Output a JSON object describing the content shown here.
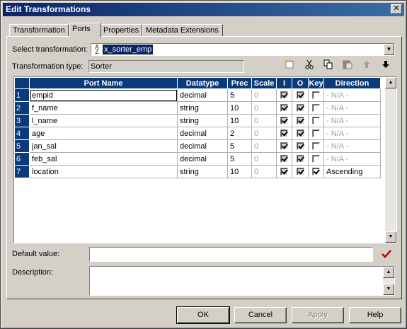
{
  "window": {
    "title": "Edit Transformations",
    "close_glyph": "✕"
  },
  "tabs": [
    {
      "label": "Transformation"
    },
    {
      "label": "Ports",
      "active": true
    },
    {
      "label": "Properties"
    },
    {
      "label": "Metadata Extensions"
    }
  ],
  "select_transformation": {
    "label": "Select transformation:",
    "sort_glyph_top": "A",
    "sort_glyph_bottom": "Z",
    "value": "x_sorter_emp",
    "dropdown_glyph": "▼"
  },
  "transformation_type": {
    "label": "Transformation type:",
    "value": "Sorter"
  },
  "toolbar": {
    "new_port_icon": "new-port-icon",
    "cut_icon": "scissors-icon",
    "copy_icon": "copy-icon",
    "paste_icon": "paste-icon",
    "move_up_icon": "arrow-up-icon",
    "move_down_icon": "arrow-down-icon"
  },
  "ports_table": {
    "columns": [
      "Port Name",
      "Datatype",
      "Prec",
      "Scale",
      "I",
      "O",
      "Key",
      "Direction"
    ],
    "rows": [
      {
        "num": "1",
        "name": "empid",
        "datatype": "decimal",
        "prec": "5",
        "scale": "0",
        "in": true,
        "out": true,
        "key": false,
        "direction": "- N/A -"
      },
      {
        "num": "2",
        "name": "f_name",
        "datatype": "string",
        "prec": "10",
        "scale": "0",
        "in": true,
        "out": true,
        "key": false,
        "direction": "- N/A -"
      },
      {
        "num": "3",
        "name": "l_name",
        "datatype": "string",
        "prec": "10",
        "scale": "0",
        "in": true,
        "out": true,
        "key": false,
        "direction": "- N/A -"
      },
      {
        "num": "4",
        "name": "age",
        "datatype": "decimal",
        "prec": "2",
        "scale": "0",
        "in": true,
        "out": true,
        "key": false,
        "direction": "- N/A -"
      },
      {
        "num": "5",
        "name": "jan_sal",
        "datatype": "decimal",
        "prec": "5",
        "scale": "0",
        "in": true,
        "out": true,
        "key": false,
        "direction": "- N/A -"
      },
      {
        "num": "6",
        "name": "feb_sal",
        "datatype": "decimal",
        "prec": "5",
        "scale": "0",
        "in": true,
        "out": true,
        "key": false,
        "direction": "- N/A -"
      },
      {
        "num": "7",
        "name": "location",
        "datatype": "string",
        "prec": "10",
        "scale": "0",
        "in": true,
        "out": true,
        "key": true,
        "direction": "Ascending"
      }
    ]
  },
  "default_value": {
    "label": "Default value:",
    "value": ""
  },
  "description": {
    "label": "Description:",
    "value": ""
  },
  "scroll_glyphs": {
    "up": "▲",
    "down": "▼"
  },
  "buttons": {
    "ok": "OK",
    "cancel": "Cancel",
    "apply": "Apply",
    "help": "Help"
  },
  "colors": {
    "title_start": "#0a246a",
    "header_bg": "#0a3a7a",
    "validate_mark": "#c00000"
  }
}
